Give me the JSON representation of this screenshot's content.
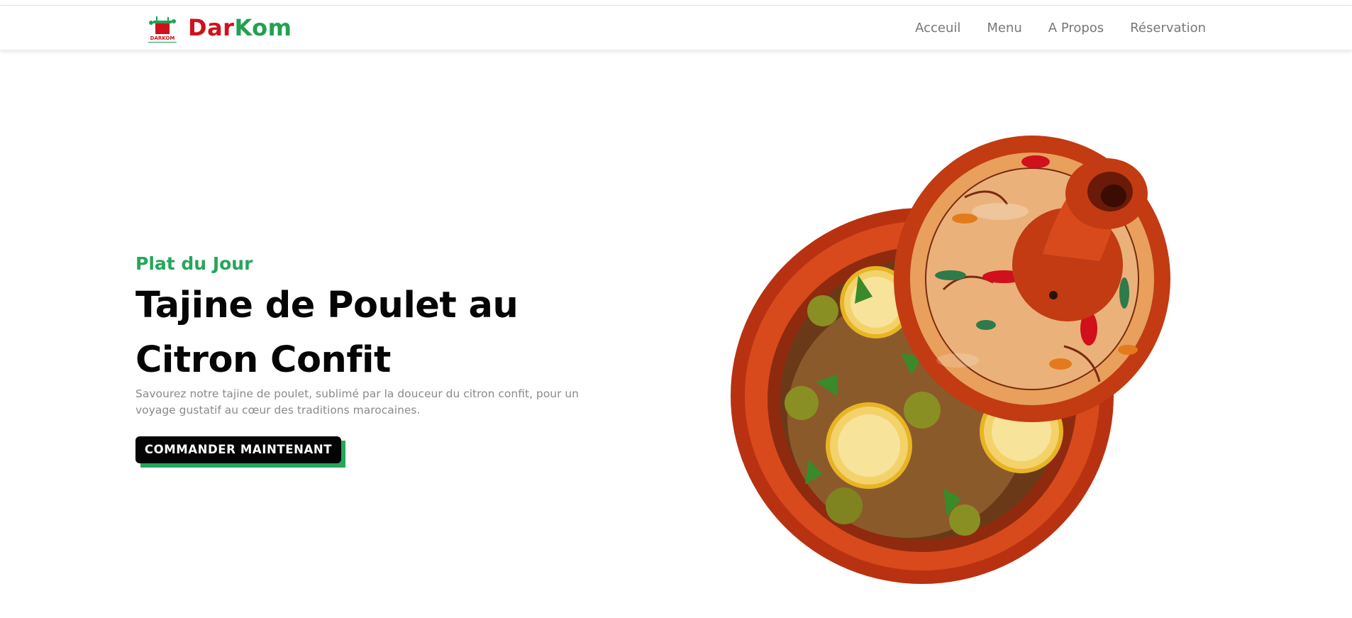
{
  "brand": {
    "logo_text": "DARKOM",
    "name_part1": "Dar",
    "name_part2": "Kom"
  },
  "nav": {
    "items": [
      {
        "label": "Acceuil"
      },
      {
        "label": "Menu"
      },
      {
        "label": "A Propos"
      },
      {
        "label": "Réservation"
      }
    ]
  },
  "hero": {
    "subtitle": "Plat du Jour",
    "title": "Tajine de Poulet au Citron Confit",
    "description": "Savourez notre tajine de poulet, sublimé par la douceur du citron confit, pour un voyage gustatif au cœur des traditions marocaines.",
    "cta_label": "COMMANDER MAINTENANT",
    "image": "tajine-image"
  },
  "colors": {
    "red": "#d0101b",
    "green": "#21a153",
    "dark": "#050505",
    "muted": "#8a8a8a"
  }
}
